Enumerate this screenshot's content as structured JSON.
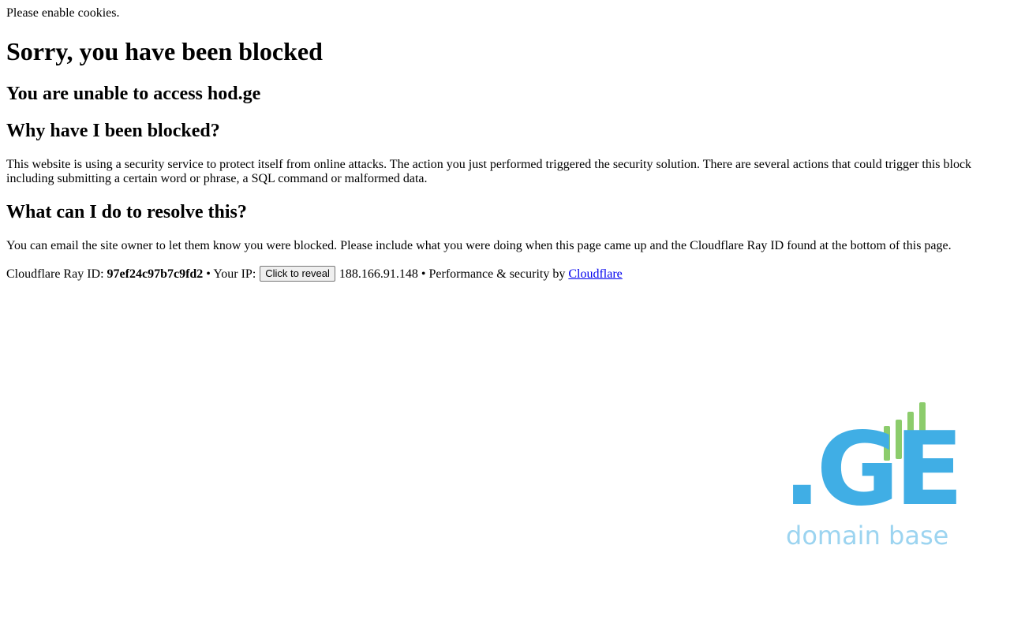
{
  "notice": {
    "cookies": "Please enable cookies."
  },
  "headings": {
    "title": "Sorry, you have been blocked",
    "subtitle": "You are unable to access hod.ge",
    "why": "Why have I been blocked?",
    "what": "What can I do to resolve this?"
  },
  "paragraphs": {
    "why": "This website is using a security service to protect itself from online attacks. The action you just performed triggered the security solution. There are several actions that could trigger this block including submitting a certain word or phrase, a SQL command or malformed data.",
    "what": "You can email the site owner to let them know you were blocked. Please include what you were doing when this page came up and the Cloudflare Ray ID found at the bottom of this page."
  },
  "footer": {
    "ray_label": "Cloudflare Ray ID: ",
    "ray_id": "97ef24c97b7c9fd2",
    "separator": " • ",
    "ip_label": "Your IP: ",
    "reveal_button": "Click to reveal",
    "ip_address": " 188.166.91.148",
    "perf_label": "Performance & security by ",
    "cloudflare_link": "Cloudflare"
  },
  "logo": {
    "mark": ".GE",
    "tagline": "domain base",
    "colors": {
      "blue": "#40aee5",
      "green": "#8ccc6c",
      "tagline": "#9cd4f0"
    }
  }
}
